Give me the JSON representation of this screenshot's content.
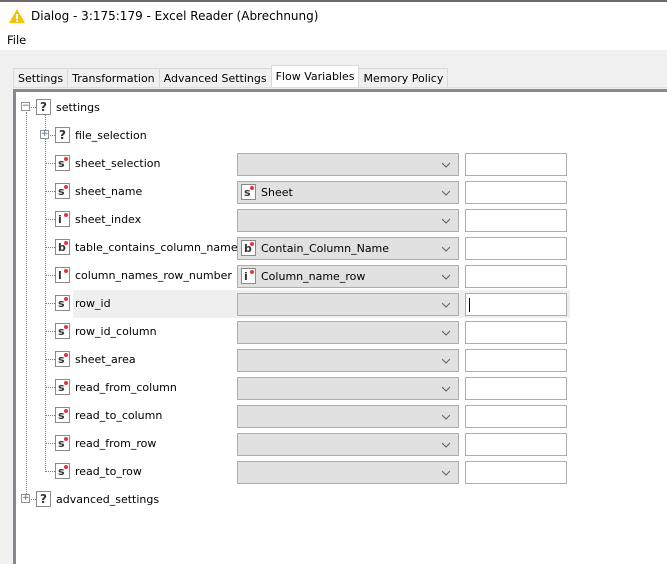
{
  "window": {
    "title": "Dialog - 3:175:179 - Excel Reader (Abrechnung)",
    "icon": "warning-triangle-icon"
  },
  "menu": {
    "items": [
      {
        "label": "File"
      }
    ]
  },
  "tabs": [
    {
      "label": "Settings",
      "active": false
    },
    {
      "label": "Transformation",
      "active": false
    },
    {
      "label": "Advanced Settings",
      "active": false
    },
    {
      "label": "Flow Variables",
      "active": true
    },
    {
      "label": "Memory Policy",
      "active": false
    }
  ],
  "tree": {
    "root": {
      "label": "settings",
      "type_icon": "?",
      "expanded": true
    },
    "file_selection": {
      "label": "file_selection",
      "type_icon": "?",
      "expanded": false
    },
    "items": [
      {
        "label": "sheet_selection",
        "type_icon": "s",
        "variable": "",
        "variable_type": "",
        "override": ""
      },
      {
        "label": "sheet_name",
        "type_icon": "s",
        "variable": "Sheet",
        "variable_type": "s",
        "override": ""
      },
      {
        "label": "sheet_index",
        "type_icon": "i",
        "variable": "",
        "variable_type": "",
        "override": ""
      },
      {
        "label": "table_contains_column_names",
        "type_icon": "b",
        "variable": "Contain_Column_Name",
        "variable_type": "b",
        "override": ""
      },
      {
        "label": "column_names_row_number",
        "type_icon": "l",
        "variable": "Column_name_row",
        "variable_type": "i",
        "override": ""
      },
      {
        "label": "row_id",
        "type_icon": "s",
        "variable": "",
        "variable_type": "",
        "override": "",
        "focused": true
      },
      {
        "label": "row_id_column",
        "type_icon": "s",
        "variable": "",
        "variable_type": "",
        "override": ""
      },
      {
        "label": "sheet_area",
        "type_icon": "s",
        "variable": "",
        "variable_type": "",
        "override": ""
      },
      {
        "label": "read_from_column",
        "type_icon": "s",
        "variable": "",
        "variable_type": "",
        "override": ""
      },
      {
        "label": "read_to_column",
        "type_icon": "s",
        "variable": "",
        "variable_type": "",
        "override": ""
      },
      {
        "label": "read_from_row",
        "type_icon": "s",
        "variable": "",
        "variable_type": "",
        "override": ""
      },
      {
        "label": "read_to_row",
        "type_icon": "s",
        "variable": "",
        "variable_type": "",
        "override": ""
      }
    ],
    "advanced": {
      "label": "advanced_settings",
      "type_icon": "?",
      "expanded": false
    }
  },
  "colors": {
    "accent_dot": "#e8353a",
    "panel_border": "#858a90",
    "combo_bg": "#e1e1e1",
    "dialog_bg": "#f0f0f0"
  }
}
